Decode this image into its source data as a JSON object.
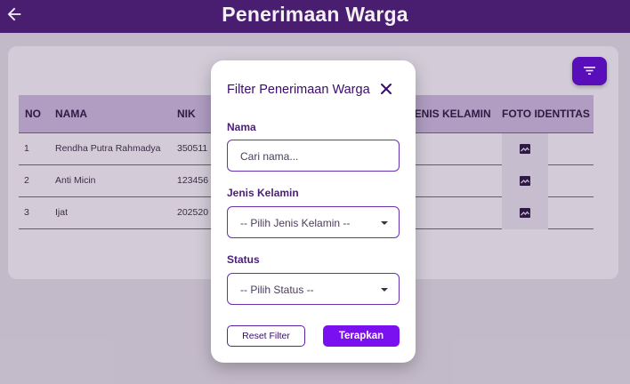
{
  "appbar": {
    "title": "Penerimaan Warga",
    "back_icon": "arrow-back-icon"
  },
  "table": {
    "headers": [
      "NO",
      "NAMA",
      "NIK",
      "JENIS KELAMIN",
      "FOTO IDENTITAS"
    ],
    "rows": [
      {
        "no": "1",
        "nama": "Rendha Putra Rahmadya",
        "nik": "350511"
      },
      {
        "no": "2",
        "nama": "Anti Micin",
        "nik": "123456"
      },
      {
        "no": "3",
        "nama": "Ijat",
        "nik": "202520"
      }
    ],
    "photo_icon": "image-icon"
  },
  "filter_button": {
    "icon": "filter-icon",
    "color": "#5a0fc0"
  },
  "dialog": {
    "title": "Filter Penerimaan Warga",
    "close_icon": "close-icon",
    "nama_label": "Nama",
    "nama_placeholder": "Cari nama...",
    "gender_label": "Jenis Kelamin",
    "gender_value": "-- Pilih Jenis Kelamin --",
    "status_label": "Status",
    "status_value": "-- Pilih Status --",
    "reset_label": "Reset Filter",
    "apply_label": "Terapkan",
    "accent": "#7a0ff0"
  }
}
